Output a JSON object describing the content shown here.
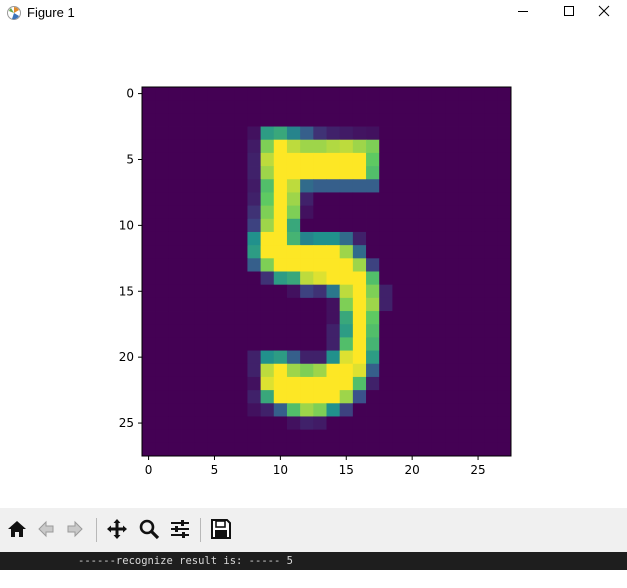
{
  "window": {
    "title": "Figure 1",
    "icons": {
      "app": "matplotlib-logo-icon",
      "minimize": "minimize-icon",
      "maximize": "maximize-icon",
      "close": "close-icon"
    }
  },
  "chart_data": {
    "type": "heatmap",
    "title": "",
    "xlabel": "",
    "ylabel": "",
    "colormap": "viridis",
    "xticks": [
      0,
      5,
      10,
      15,
      20,
      25
    ],
    "yticks": [
      0,
      5,
      10,
      15,
      20,
      25
    ],
    "xlim": [
      -0.5,
      27.5
    ],
    "ylim": [
      27.5,
      -0.5
    ],
    "grid": false,
    "shape": [
      28,
      28
    ],
    "pixels": [
      [
        0,
        0,
        0,
        0,
        0,
        0,
        0,
        0,
        0,
        0,
        0,
        0,
        0,
        0,
        0,
        0,
        0,
        0,
        0,
        0,
        0,
        0,
        0,
        0,
        0,
        0,
        0,
        0
      ],
      [
        0,
        0,
        0,
        0,
        0,
        0,
        0,
        0,
        0,
        0,
        0,
        0,
        0,
        0,
        0,
        0,
        0,
        0,
        0,
        0,
        0,
        0,
        0,
        0,
        0,
        0,
        0,
        0
      ],
      [
        0,
        0,
        0,
        0,
        0,
        0,
        0,
        0,
        0,
        0,
        0,
        0,
        0,
        0,
        0,
        0,
        0,
        0,
        0,
        0,
        0,
        0,
        0,
        0,
        0,
        0,
        0,
        0
      ],
      [
        0,
        0,
        0,
        0,
        0,
        0,
        0,
        0,
        0.05,
        0.55,
        0.6,
        0.45,
        0.3,
        0.15,
        0.1,
        0.08,
        0.06,
        0.05,
        0,
        0,
        0,
        0,
        0,
        0,
        0,
        0,
        0,
        0
      ],
      [
        0,
        0,
        0,
        0,
        0,
        0,
        0,
        0,
        0.08,
        0.8,
        1,
        0.9,
        0.85,
        0.85,
        0.88,
        0.9,
        0.85,
        0.8,
        0,
        0,
        0,
        0,
        0,
        0,
        0,
        0,
        0,
        0
      ],
      [
        0,
        0,
        0,
        0,
        0,
        0,
        0,
        0,
        0.1,
        0.9,
        1,
        1,
        1,
        1,
        1,
        1,
        1,
        0.75,
        0,
        0,
        0,
        0,
        0,
        0,
        0,
        0,
        0,
        0
      ],
      [
        0,
        0,
        0,
        0,
        0,
        0,
        0,
        0,
        0.1,
        0.85,
        1,
        1,
        1,
        1,
        1,
        1,
        1,
        0.7,
        0,
        0,
        0,
        0,
        0,
        0,
        0,
        0,
        0,
        0
      ],
      [
        0,
        0,
        0,
        0,
        0,
        0,
        0,
        0,
        0.08,
        0.7,
        1,
        0.9,
        0.35,
        0.3,
        0.3,
        0.3,
        0.3,
        0.3,
        0,
        0,
        0,
        0,
        0,
        0,
        0,
        0,
        0,
        0
      ],
      [
        0,
        0,
        0,
        0,
        0,
        0,
        0,
        0,
        0.1,
        0.75,
        1,
        0.85,
        0.1,
        0,
        0,
        0,
        0,
        0,
        0,
        0,
        0,
        0,
        0,
        0,
        0,
        0,
        0,
        0
      ],
      [
        0,
        0,
        0,
        0,
        0,
        0,
        0,
        0,
        0.15,
        0.8,
        1,
        0.8,
        0.05,
        0,
        0,
        0,
        0,
        0,
        0,
        0,
        0,
        0,
        0,
        0,
        0,
        0,
        0,
        0
      ],
      [
        0,
        0,
        0,
        0,
        0,
        0,
        0,
        0,
        0.2,
        0.85,
        1,
        0.6,
        0,
        0,
        0,
        0,
        0,
        0,
        0,
        0,
        0,
        0,
        0,
        0,
        0,
        0,
        0,
        0
      ],
      [
        0,
        0,
        0,
        0,
        0,
        0,
        0,
        0,
        0.5,
        1,
        1,
        0.65,
        0.45,
        0.5,
        0.5,
        0.35,
        0.1,
        0,
        0,
        0,
        0,
        0,
        0,
        0,
        0,
        0,
        0,
        0
      ],
      [
        0,
        0,
        0,
        0,
        0,
        0,
        0,
        0,
        0.55,
        1,
        1,
        1,
        1,
        1,
        1,
        0.85,
        0.35,
        0,
        0,
        0,
        0,
        0,
        0,
        0,
        0,
        0,
        0,
        0
      ],
      [
        0,
        0,
        0,
        0,
        0,
        0,
        0,
        0,
        0.3,
        0.8,
        1,
        1,
        1,
        1,
        1,
        1,
        0.85,
        0.2,
        0,
        0,
        0,
        0,
        0,
        0,
        0,
        0,
        0,
        0
      ],
      [
        0,
        0,
        0,
        0,
        0,
        0,
        0,
        0,
        0,
        0.15,
        0.55,
        0.6,
        0.9,
        0.95,
        1,
        1,
        1,
        0.7,
        0,
        0,
        0,
        0,
        0,
        0,
        0,
        0,
        0,
        0
      ],
      [
        0,
        0,
        0,
        0,
        0,
        0,
        0,
        0,
        0,
        0,
        0,
        0.05,
        0.2,
        0.15,
        0.4,
        0.9,
        1,
        0.8,
        0.1,
        0,
        0,
        0,
        0,
        0,
        0,
        0,
        0,
        0
      ],
      [
        0,
        0,
        0,
        0,
        0,
        0,
        0,
        0,
        0,
        0,
        0,
        0,
        0,
        0,
        0.05,
        0.8,
        1,
        0.85,
        0.1,
        0,
        0,
        0,
        0,
        0,
        0,
        0,
        0,
        0
      ],
      [
        0,
        0,
        0,
        0,
        0,
        0,
        0,
        0,
        0,
        0,
        0,
        0,
        0,
        0,
        0.05,
        0.6,
        1,
        0.75,
        0,
        0,
        0,
        0,
        0,
        0,
        0,
        0,
        0,
        0
      ],
      [
        0,
        0,
        0,
        0,
        0,
        0,
        0,
        0,
        0,
        0,
        0,
        0,
        0,
        0,
        0.1,
        0.55,
        1,
        0.7,
        0,
        0,
        0,
        0,
        0,
        0,
        0,
        0,
        0,
        0
      ],
      [
        0,
        0,
        0,
        0,
        0,
        0,
        0,
        0,
        0,
        0,
        0,
        0,
        0,
        0,
        0.1,
        0.7,
        1,
        0.65,
        0,
        0,
        0,
        0,
        0,
        0,
        0,
        0,
        0,
        0
      ],
      [
        0,
        0,
        0,
        0,
        0,
        0,
        0,
        0,
        0.1,
        0.5,
        0.55,
        0.3,
        0.1,
        0.1,
        0.5,
        0.95,
        1,
        0.55,
        0,
        0,
        0,
        0,
        0,
        0,
        0,
        0,
        0,
        0
      ],
      [
        0,
        0,
        0,
        0,
        0,
        0,
        0,
        0,
        0.1,
        0.9,
        1,
        0.85,
        0.8,
        0.85,
        1,
        1,
        0.95,
        0.3,
        0,
        0,
        0,
        0,
        0,
        0,
        0,
        0,
        0,
        0
      ],
      [
        0,
        0,
        0,
        0,
        0,
        0,
        0,
        0,
        0.05,
        0.95,
        1,
        1,
        1,
        1,
        1,
        1,
        0.7,
        0.1,
        0,
        0,
        0,
        0,
        0,
        0,
        0,
        0,
        0,
        0
      ],
      [
        0,
        0,
        0,
        0,
        0,
        0,
        0,
        0,
        0.1,
        0.6,
        1,
        1,
        1,
        1,
        1,
        0.85,
        0.25,
        0,
        0,
        0,
        0,
        0,
        0,
        0,
        0,
        0,
        0,
        0
      ],
      [
        0,
        0,
        0,
        0,
        0,
        0,
        0,
        0,
        0.05,
        0.1,
        0.3,
        0.7,
        0.85,
        0.8,
        0.5,
        0.2,
        0,
        0,
        0,
        0,
        0,
        0,
        0,
        0,
        0,
        0,
        0,
        0
      ],
      [
        0,
        0,
        0,
        0,
        0,
        0,
        0,
        0,
        0,
        0,
        0,
        0.05,
        0.1,
        0.08,
        0,
        0,
        0,
        0,
        0,
        0,
        0,
        0,
        0,
        0,
        0,
        0,
        0,
        0
      ],
      [
        0,
        0,
        0,
        0,
        0,
        0,
        0,
        0,
        0,
        0,
        0,
        0,
        0,
        0,
        0,
        0,
        0,
        0,
        0,
        0,
        0,
        0,
        0,
        0,
        0,
        0,
        0,
        0
      ],
      [
        0,
        0,
        0,
        0,
        0,
        0,
        0,
        0,
        0,
        0,
        0,
        0,
        0,
        0,
        0,
        0,
        0,
        0,
        0,
        0,
        0,
        0,
        0,
        0,
        0,
        0,
        0,
        0
      ]
    ]
  },
  "toolbar": {
    "buttons": [
      {
        "name": "home-button",
        "icon": "home-icon"
      },
      {
        "name": "back-button",
        "icon": "back-arrow-icon"
      },
      {
        "name": "forward-button",
        "icon": "forward-arrow-icon"
      },
      {
        "name": "pan-button",
        "icon": "pan-icon"
      },
      {
        "name": "zoom-button",
        "icon": "zoom-icon"
      },
      {
        "name": "configure-subplots-button",
        "icon": "sliders-icon"
      },
      {
        "name": "save-button",
        "icon": "save-icon"
      }
    ]
  },
  "console": {
    "text": "------recognize result is: ----- 5"
  }
}
